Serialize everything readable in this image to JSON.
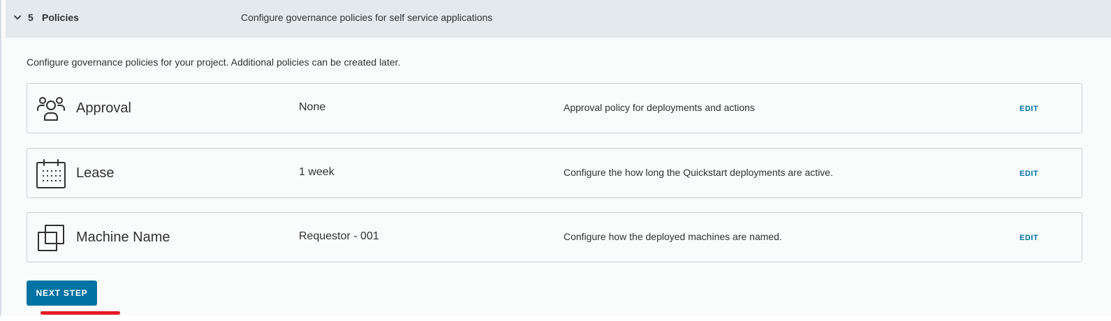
{
  "step": {
    "number": "5",
    "title": "Policies",
    "description": "Configure governance policies for self service applications"
  },
  "intro": "Configure governance policies for your project. Additional policies can be created later.",
  "policies": [
    {
      "icon": "people-group-icon",
      "name": "Approval",
      "value": "None",
      "description": "Approval policy for deployments and actions",
      "edit_label": "EDIT"
    },
    {
      "icon": "calendar-icon",
      "name": "Lease",
      "value": "1 week",
      "description": "Configure the how long the Quickstart deployments are active.",
      "edit_label": "EDIT"
    },
    {
      "icon": "copy-boxes-icon",
      "name": "Machine Name",
      "value": "Requestor - 001",
      "description": "Configure how the deployed machines are named.",
      "edit_label": "EDIT"
    }
  ],
  "next_button_label": "NEXT STEP",
  "colors": {
    "accent": "#0072a3",
    "header_bg": "#e3e9ed",
    "highlight": "#e31b23"
  }
}
